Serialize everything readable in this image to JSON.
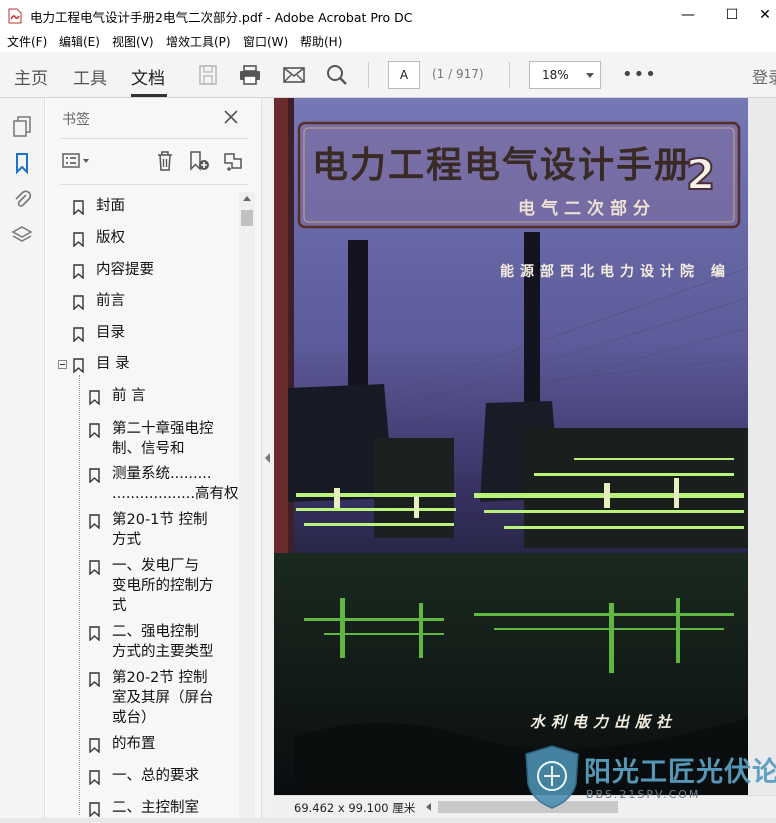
{
  "window": {
    "title": "电力工程电气设计手册2电气二次部分.pdf - Adobe Acrobat Pro DC",
    "minimize_glyph": "—",
    "maximize_glyph": "☐",
    "close_glyph": "✕"
  },
  "menubar": {
    "items": [
      "文件(F)",
      "编辑(E)",
      "视图(V)",
      "增效工具(P)",
      "窗口(W)",
      "帮助(H)"
    ]
  },
  "toolbar": {
    "tabs": [
      "主页",
      "工具",
      "文档"
    ],
    "active_tab": "文档",
    "page_number": "A",
    "page_count": "(1 / 917)",
    "zoom": "18%",
    "more": "•••",
    "login": "登录"
  },
  "bookmarks_panel": {
    "title": "书签",
    "items": [
      {
        "label": "封面"
      },
      {
        "label": "版权"
      },
      {
        "label": "内容提要"
      },
      {
        "label": "前言"
      },
      {
        "label": "目录"
      },
      {
        "label": "目   录",
        "expanded": true
      },
      {
        "label": "前   言",
        "child": true
      },
      {
        "label": "第二十章强电控",
        "label2": "制、信号和",
        "child": true
      },
      {
        "label": "  测量系统.........",
        "label2": "..................高有权",
        "child": true
      },
      {
        "label": " 第20-1节  控制",
        "label2": "方式",
        "child": true
      },
      {
        "label": "  一、发电厂与",
        "label2": "变电所的控制方",
        "label3": "式",
        "child": true
      },
      {
        "label": "  二、强电控制",
        "label2": "方式的主要类型",
        "child": true
      },
      {
        "label": " 第20-2节  控制",
        "label2": "室及其屏（屏台",
        "label3": "或台）",
        "child": true
      },
      {
        "label": "  的布置",
        "child": true
      },
      {
        "label": "  一、总的要求",
        "child": true
      },
      {
        "label": "  二、主控制室",
        "child": true
      }
    ]
  },
  "document": {
    "cover_title": "电力工程电气设计手册",
    "cover_volume": "2",
    "cover_subtitle": "电气二次部分",
    "cover_org": "能源部西北电力设计院 编",
    "cover_publisher": "水利电力出版社",
    "cover_colors": {
      "sky_top": "#6b6fa8",
      "sky_mid": "#3a3466",
      "night": "#121426",
      "lights": "#9cf26a",
      "frame": "#6a3a3a"
    }
  },
  "statusbar": {
    "page_size": "69.462 x 99.100 厘米"
  },
  "watermark": {
    "brand": "阳光工匠光伏论坛",
    "url": "BBS.21SPV.COM"
  }
}
